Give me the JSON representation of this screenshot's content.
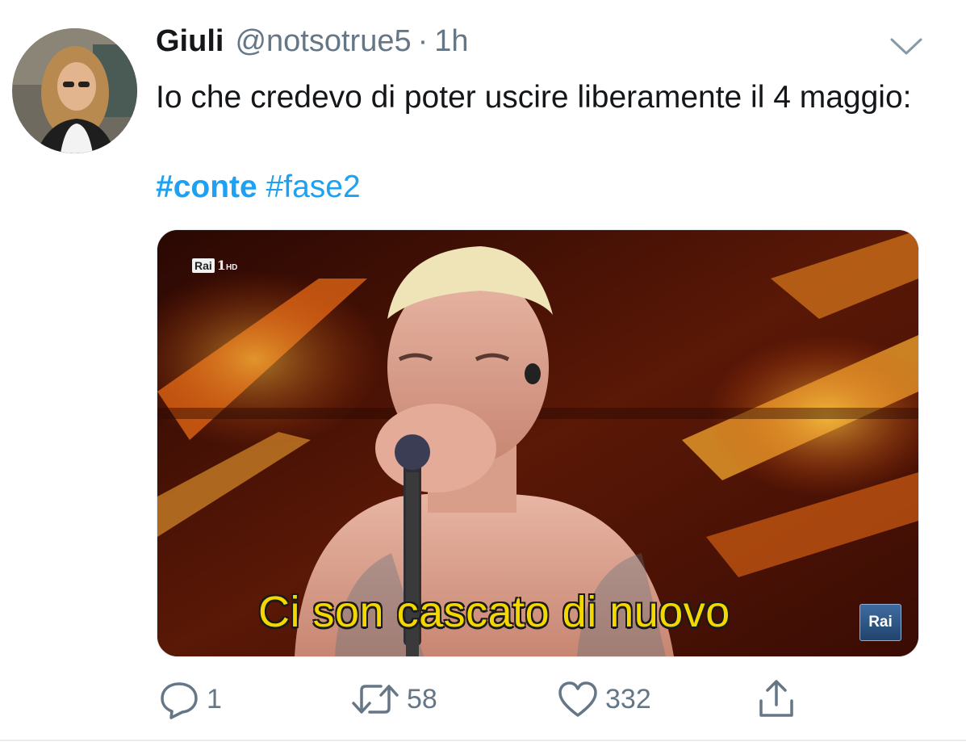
{
  "tweet": {
    "display_name": "Giuli",
    "handle": "@notsotrue5",
    "separator": "·",
    "timestamp": "1h",
    "text": "Io che credevo di poter uscire liberamente il 4 maggio:",
    "hashtags": [
      "#conte",
      "#fase2"
    ]
  },
  "media": {
    "channel_logo_box": "Rai",
    "channel_number": "1",
    "channel_hd": "HD",
    "subtitle": "Ci son cascato di nuovo",
    "corner_logo": "Rai"
  },
  "actions": {
    "reply_count": "1",
    "retweet_count": "58",
    "like_count": "332"
  },
  "colors": {
    "accent": "#1da1f2",
    "secondary_text": "#657786",
    "primary_text": "#14171a",
    "subtitle_yellow": "#f5d700"
  },
  "icons": [
    "reply-icon",
    "retweet-icon",
    "like-icon",
    "share-icon",
    "chevron-down-icon"
  ]
}
